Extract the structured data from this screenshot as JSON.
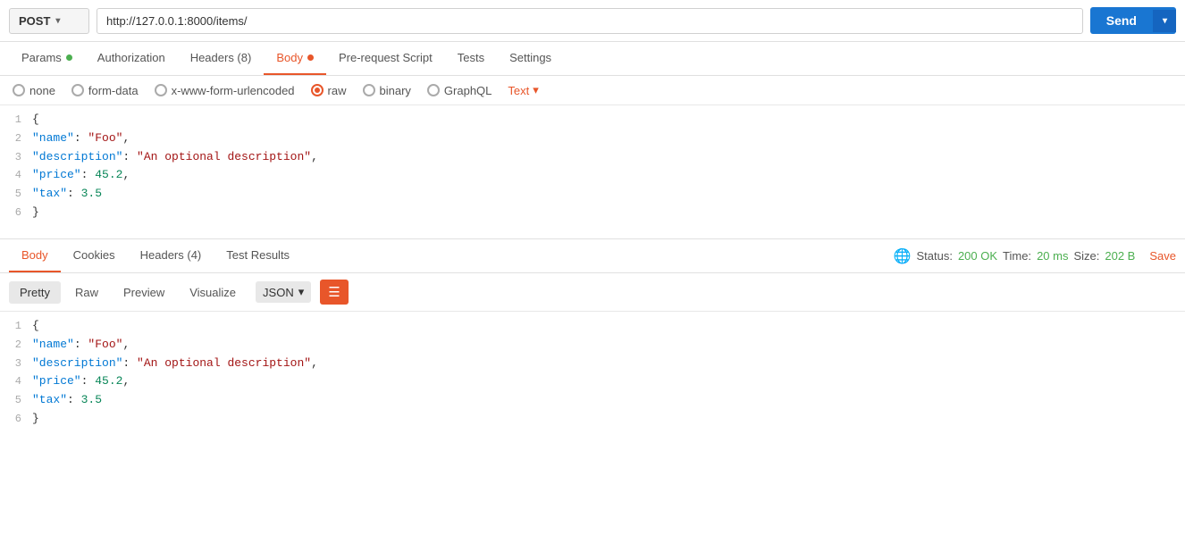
{
  "url_bar": {
    "method": "POST",
    "url": "http://127.0.0.1:8000/items/",
    "send_label": "Send",
    "chevron": "▾"
  },
  "req_tabs": [
    {
      "id": "params",
      "label": "Params",
      "dot": "green",
      "active": false
    },
    {
      "id": "authorization",
      "label": "Authorization",
      "dot": null,
      "active": false
    },
    {
      "id": "headers",
      "label": "Headers (8)",
      "dot": null,
      "active": false
    },
    {
      "id": "body",
      "label": "Body",
      "dot": "orange",
      "active": true
    },
    {
      "id": "pre-request",
      "label": "Pre-request Script",
      "dot": null,
      "active": false
    },
    {
      "id": "tests",
      "label": "Tests",
      "dot": null,
      "active": false
    },
    {
      "id": "settings",
      "label": "Settings",
      "dot": null,
      "active": false
    }
  ],
  "body_types": [
    {
      "id": "none",
      "label": "none",
      "selected": false
    },
    {
      "id": "form-data",
      "label": "form-data",
      "selected": false
    },
    {
      "id": "x-www-form-urlencoded",
      "label": "x-www-form-urlencoded",
      "selected": false
    },
    {
      "id": "raw",
      "label": "raw",
      "selected": true
    },
    {
      "id": "binary",
      "label": "binary",
      "selected": false
    },
    {
      "id": "graphql",
      "label": "GraphQL",
      "selected": false
    }
  ],
  "text_format": {
    "label": "Text",
    "chevron": "▾"
  },
  "request_body": {
    "lines": [
      {
        "num": "1",
        "content": "{"
      },
      {
        "num": "2",
        "content": "    \"name\": \"Foo\","
      },
      {
        "num": "3",
        "content": "    \"description\": \"An optional description\","
      },
      {
        "num": "4",
        "content": "    \"price\": 45.2,"
      },
      {
        "num": "5",
        "content": "    \"tax\": 3.5"
      },
      {
        "num": "6",
        "content": "}"
      }
    ]
  },
  "resp_tabs": [
    {
      "id": "body",
      "label": "Body",
      "active": true
    },
    {
      "id": "cookies",
      "label": "Cookies",
      "active": false
    },
    {
      "id": "headers",
      "label": "Headers (4)",
      "active": false
    },
    {
      "id": "test-results",
      "label": "Test Results",
      "active": false
    }
  ],
  "status_bar": {
    "status_label": "Status:",
    "status_value": "200 OK",
    "time_label": "Time:",
    "time_value": "20 ms",
    "size_label": "Size:",
    "size_value": "202 B",
    "save_label": "Save"
  },
  "resp_format": {
    "tabs": [
      {
        "id": "pretty",
        "label": "Pretty",
        "active": true
      },
      {
        "id": "raw",
        "label": "Raw",
        "active": false
      },
      {
        "id": "preview",
        "label": "Preview",
        "active": false
      },
      {
        "id": "visualize",
        "label": "Visualize",
        "active": false
      }
    ],
    "format_select": "JSON",
    "chevron": "▾"
  },
  "response_body": {
    "lines": [
      {
        "num": "1",
        "content": "{"
      },
      {
        "num": "2",
        "content": "    \"name\": \"Foo\","
      },
      {
        "num": "3",
        "content": "    \"description\": \"An optional description\","
      },
      {
        "num": "4",
        "content": "    \"price\": 45.2,"
      },
      {
        "num": "5",
        "content": "    \"tax\": 3.5"
      },
      {
        "num": "6",
        "content": "}"
      }
    ]
  }
}
